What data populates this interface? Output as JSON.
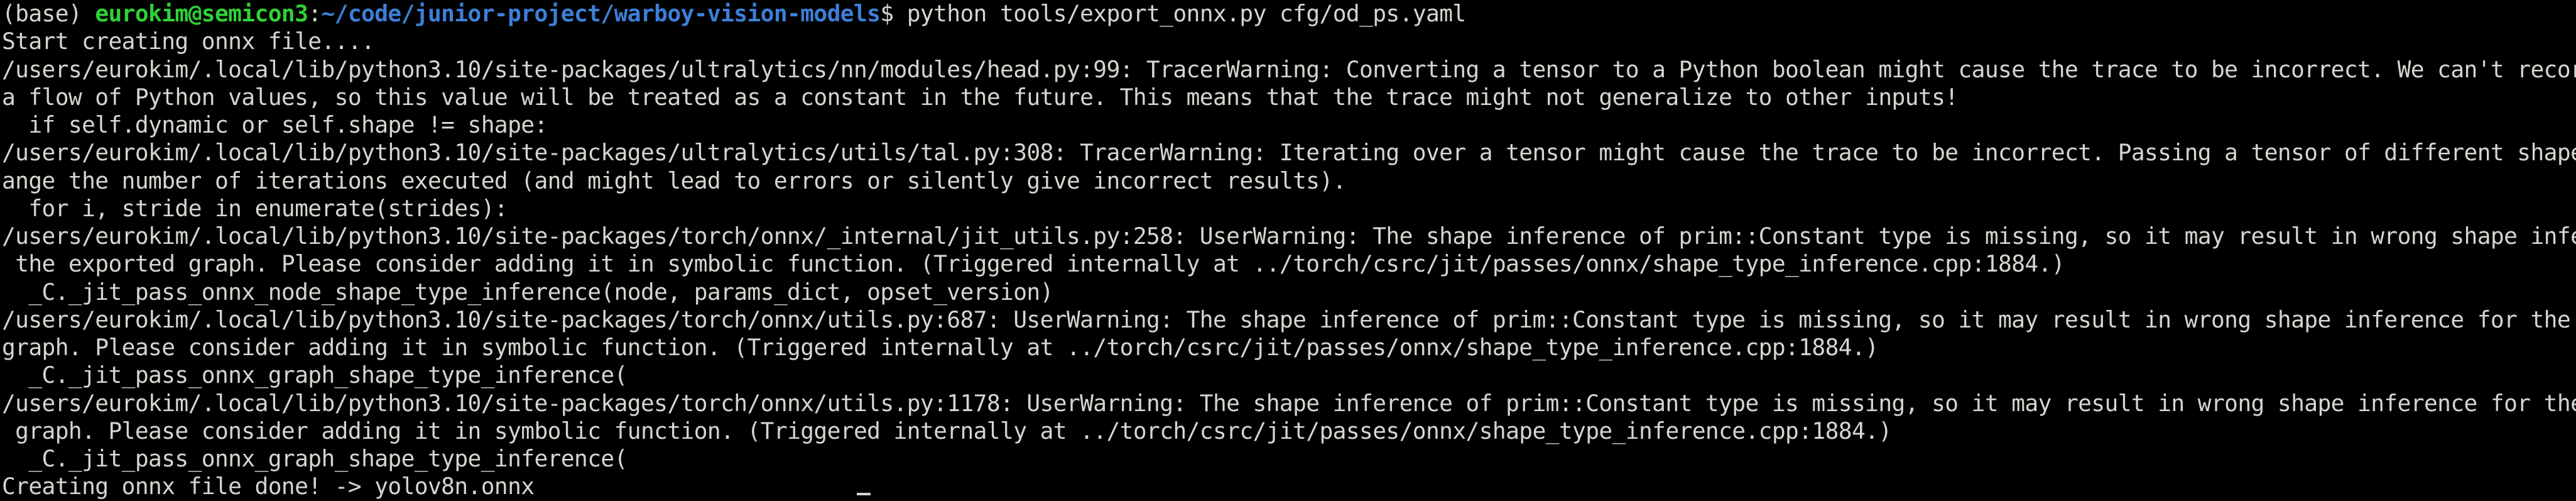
{
  "prompt": {
    "env": "(base) ",
    "user_host": "eurokim@semicon3",
    "colon": ":",
    "path": "~/code/junior-project/warboy-vision-models",
    "symbol": "$ ",
    "command": "python tools/export_onnx.py cfg/od_ps.yaml"
  },
  "output": [
    "Start creating onnx file....",
    "/users/eurokim/.local/lib/python3.10/site-packages/ultralytics/nn/modules/head.py:99: TracerWarning: Converting a tensor to a Python boolean might cause the trace to be incorrect. We can't record the dat",
    "a flow of Python values, so this value will be treated as a constant in the future. This means that the trace might not generalize to other inputs!",
    "  if self.dynamic or self.shape != shape:",
    "/users/eurokim/.local/lib/python3.10/site-packages/ultralytics/utils/tal.py:308: TracerWarning: Iterating over a tensor might cause the trace to be incorrect. Passing a tensor of different shape won't ch",
    "ange the number of iterations executed (and might lead to errors or silently give incorrect results).",
    "  for i, stride in enumerate(strides):",
    "/users/eurokim/.local/lib/python3.10/site-packages/torch/onnx/_internal/jit_utils.py:258: UserWarning: The shape inference of prim::Constant type is missing, so it may result in wrong shape inference for",
    " the exported graph. Please consider adding it in symbolic function. (Triggered internally at ../torch/csrc/jit/passes/onnx/shape_type_inference.cpp:1884.)",
    "  _C._jit_pass_onnx_node_shape_type_inference(node, params_dict, opset_version)",
    "/users/eurokim/.local/lib/python3.10/site-packages/torch/onnx/utils.py:687: UserWarning: The shape inference of prim::Constant type is missing, so it may result in wrong shape inference for the exported",
    "graph. Please consider adding it in symbolic function. (Triggered internally at ../torch/csrc/jit/passes/onnx/shape_type_inference.cpp:1884.)",
    "  _C._jit_pass_onnx_graph_shape_type_inference(",
    "/users/eurokim/.local/lib/python3.10/site-packages/torch/onnx/utils.py:1178: UserWarning: The shape inference of prim::Constant type is missing, so it may result in wrong shape inference for the exported",
    " graph. Please consider adding it in symbolic function. (Triggered internally at ../torch/csrc/jit/passes/onnx/shape_type_inference.cpp:1884.)",
    "  _C._jit_pass_onnx_graph_shape_type_inference(",
    "Creating onnx file done! -> yolov8n.onnx"
  ],
  "colors": {
    "background": "#000000",
    "text": "#d3d7cf",
    "user_host": "#2fd235",
    "path": "#3c7fd8"
  }
}
